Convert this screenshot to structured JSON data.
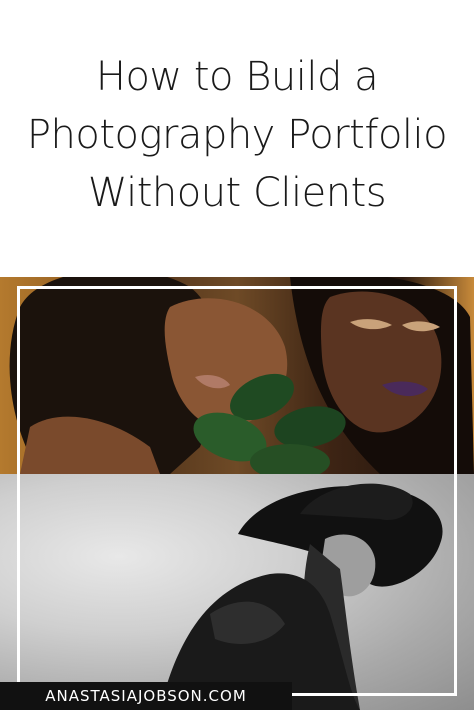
{
  "title": {
    "line1": "How to Build a",
    "line2": "Photography Portfolio",
    "line3": "Without Clients"
  },
  "watermark": "ANASTASIAJOBSON.COM",
  "colors": {
    "background": "#ffffff",
    "title_text": "#1a1a1a",
    "watermark_bg": "#111111",
    "frame": "#ffffff"
  }
}
